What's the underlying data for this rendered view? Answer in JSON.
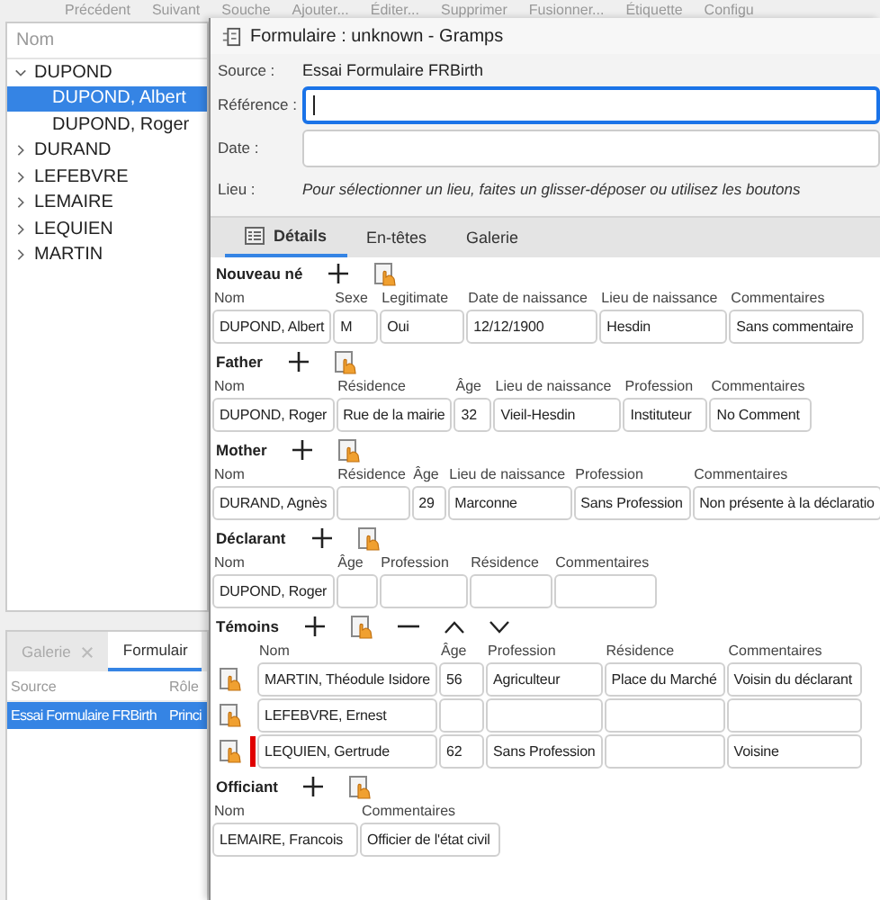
{
  "toolbar": [
    "Précédent",
    "Suivant",
    "Souche",
    "Ajouter...",
    "Éditer...",
    "Supprimer",
    "Fusionner...",
    "Étiquette",
    "Configu"
  ],
  "tree": {
    "header": "Nom",
    "items": [
      {
        "label": "DUPOND",
        "expanded": true,
        "selected": false,
        "children": [
          {
            "label": "DUPOND, Albert",
            "selected": true
          },
          {
            "label": "DUPOND, Roger",
            "selected": false
          }
        ]
      },
      {
        "label": "DURAND",
        "expanded": false,
        "selected": false
      },
      {
        "label": "LEFEBVRE",
        "expanded": false,
        "selected": false
      },
      {
        "label": "LEMAIRE",
        "expanded": false,
        "selected": false
      },
      {
        "label": "LEQUIEN",
        "expanded": false,
        "selected": false
      },
      {
        "label": "MARTIN",
        "expanded": false,
        "selected": false
      }
    ]
  },
  "bottom_panel": {
    "tabs": [
      {
        "label": "Galerie",
        "selected": false,
        "closable": true
      },
      {
        "label": "Formulair",
        "selected": true,
        "closable": false
      }
    ],
    "columns": [
      "Source",
      "Rôle"
    ],
    "rows": [
      {
        "cells": [
          "Essai Formulaire FRBirth",
          "Princi"
        ],
        "selected": true
      }
    ]
  },
  "dialog": {
    "title": "Formulaire : unknown - Gramps",
    "fields": [
      {
        "label": "Source :",
        "kind": "text",
        "value": "Essai Formulaire FRBirth"
      },
      {
        "label": "Référence :",
        "kind": "input",
        "focused": true
      },
      {
        "label": "Date :",
        "kind": "input",
        "focused": false
      },
      {
        "label": "Lieu :",
        "kind": "hint",
        "value": "Pour sélectionner un lieu, faites un glisser-déposer ou utilisez les boutons"
      }
    ],
    "tabs": [
      {
        "label": "Détails",
        "selected": true
      },
      {
        "label": "En-têtes",
        "selected": false
      },
      {
        "label": "Galerie",
        "selected": false
      }
    ],
    "sections": [
      {
        "title": "Nouveau né",
        "kind": "single",
        "actions": [
          {
            "kind": "add"
          },
          {
            "kind": "select"
          }
        ],
        "columns": [
          "Nom",
          "Sexe",
          "Legitimate",
          "Date de naissance",
          "Lieu de naissance",
          "Commentaires"
        ],
        "rows": [
          {
            "cells": [
              "DUPOND, Albert",
              "M",
              "Oui",
              "12/12/1900",
              "Hesdin",
              "Sans commentaire"
            ]
          }
        ]
      },
      {
        "title": "Father",
        "kind": "single",
        "actions": [
          {
            "kind": "add"
          },
          {
            "kind": "select"
          }
        ],
        "columns": [
          "Nom",
          "Résidence",
          "Âge",
          "Lieu de naissance",
          "Profession",
          "Commentaires"
        ],
        "rows": [
          {
            "cells": [
              "DUPOND, Roger",
              "Rue  de la mairie",
              "32",
              "Vieil-Hesdin",
              "Instituteur",
              "No Comment"
            ]
          }
        ]
      },
      {
        "title": "Mother",
        "kind": "single",
        "actions": [
          {
            "kind": "add"
          },
          {
            "kind": "select"
          }
        ],
        "columns": [
          "Nom",
          "Résidence",
          "Âge",
          "Lieu de naissance",
          "Profession",
          "Commentaires"
        ],
        "rows": [
          {
            "cells": [
              "DURAND, Agnès",
              null,
              "29",
              "Marconne",
              "Sans Profession",
              "Non présente à la déclaratio"
            ]
          }
        ]
      },
      {
        "title": "Déclarant",
        "kind": "single",
        "actions": [
          {
            "kind": "add"
          },
          {
            "kind": "select"
          }
        ],
        "columns": [
          "Nom",
          "Âge",
          "Profession",
          "Résidence",
          "Commentaires"
        ],
        "rows": [
          {
            "cells": [
              "DUPOND, Roger",
              null,
              null,
              null,
              null
            ]
          }
        ]
      },
      {
        "title": "Témoins",
        "kind": "list",
        "actions": [
          {
            "kind": "add"
          },
          {
            "kind": "select"
          },
          {
            "kind": "remove"
          },
          {
            "kind": "up"
          },
          {
            "kind": "down"
          }
        ],
        "columns": [
          "Nom",
          "Âge",
          "Profession",
          "Résidence",
          "Commentaires"
        ],
        "rows": [
          {
            "cells": [
              "MARTIN, Théodule Isidore",
              "56",
              "Agriculteur",
              "Place du Marché",
              "Voisin du déclarant"
            ],
            "marked": false
          },
          {
            "cells": [
              "LEFEBVRE, Ernest",
              null,
              null,
              null,
              null
            ],
            "marked": false
          },
          {
            "cells": [
              "LEQUIEN, Gertrude",
              "62",
              "Sans Profession",
              null,
              "Voisine"
            ],
            "marked": true
          }
        ]
      },
      {
        "title": "Officiant",
        "kind": "single",
        "actions": [
          {
            "kind": "add"
          },
          {
            "kind": "select"
          }
        ],
        "columns": [
          "Nom",
          "Commentaires"
        ],
        "rows": [
          {
            "cells": [
              "LEMAIRE, Francois",
              "Officier de l'état civil"
            ]
          }
        ]
      }
    ]
  }
}
